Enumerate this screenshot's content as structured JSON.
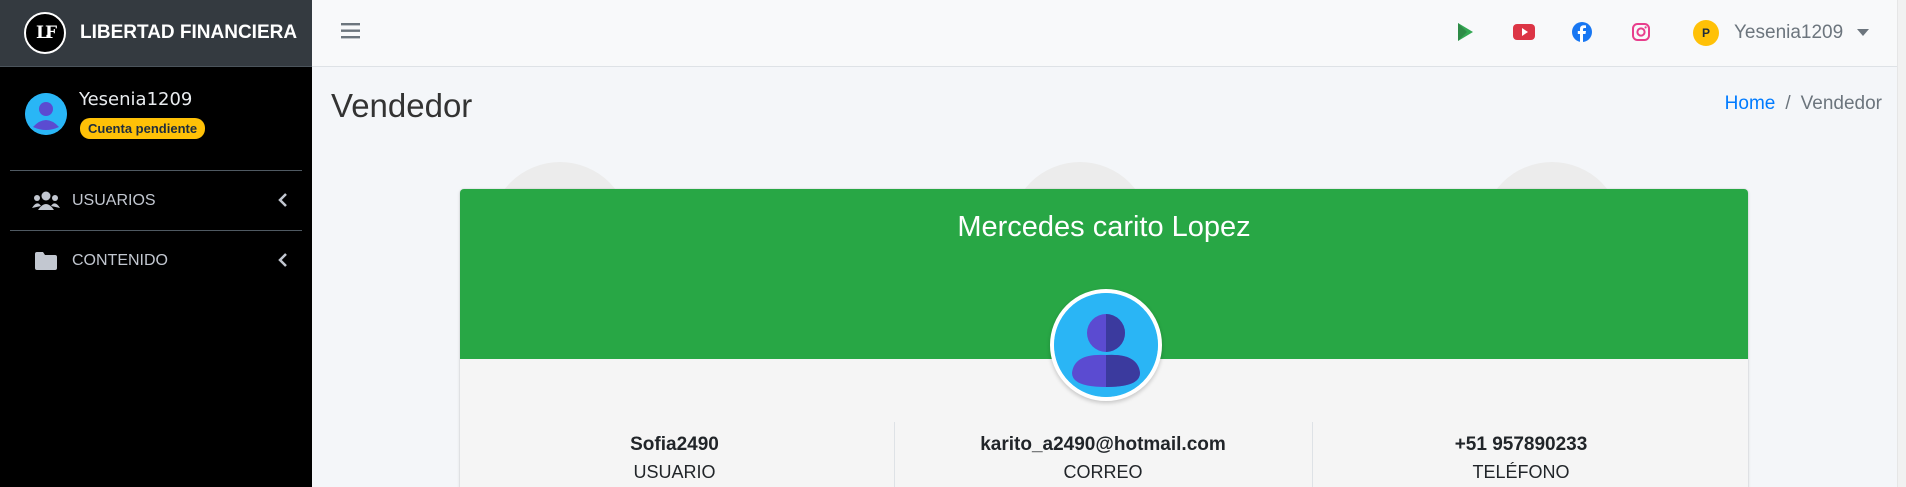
{
  "brand": {
    "logo_text": "LF",
    "name": "LIBERTAD FINANCIERA"
  },
  "user_panel": {
    "username": "Yesenia1209",
    "status_badge": "Cuenta pendiente"
  },
  "sidebar": {
    "items": [
      {
        "label": "USUARIOS",
        "icon": "users-icon"
      },
      {
        "label": "CONTENIDO",
        "icon": "folder-icon"
      }
    ]
  },
  "topbar": {
    "icons": [
      "google-play-icon",
      "youtube-icon",
      "facebook-icon",
      "instagram-icon"
    ],
    "avatar_letter": "P",
    "username": "Yesenia1209"
  },
  "page": {
    "title": "Vendedor",
    "breadcrumb": {
      "home": "Home",
      "separator": "/",
      "current": "Vendedor"
    }
  },
  "profile_card": {
    "name": "Mercedes carito Lopez",
    "header_color": "#28a745",
    "stats": [
      {
        "value": "Sofia2490",
        "label": "USUARIO"
      },
      {
        "value": "karito_a2490@hotmail.com",
        "label": "CORREO"
      },
      {
        "value": "+51 957890233",
        "label": "TELÉFONO"
      }
    ]
  },
  "colors": {
    "sidebar_bg": "#000000",
    "brand_bg": "#343a40",
    "badge": "#ffc107",
    "link": "#007bff",
    "play": "#34a853",
    "youtube": "#dc3545",
    "facebook": "#1877f2",
    "instagram": "#e83e8c"
  }
}
